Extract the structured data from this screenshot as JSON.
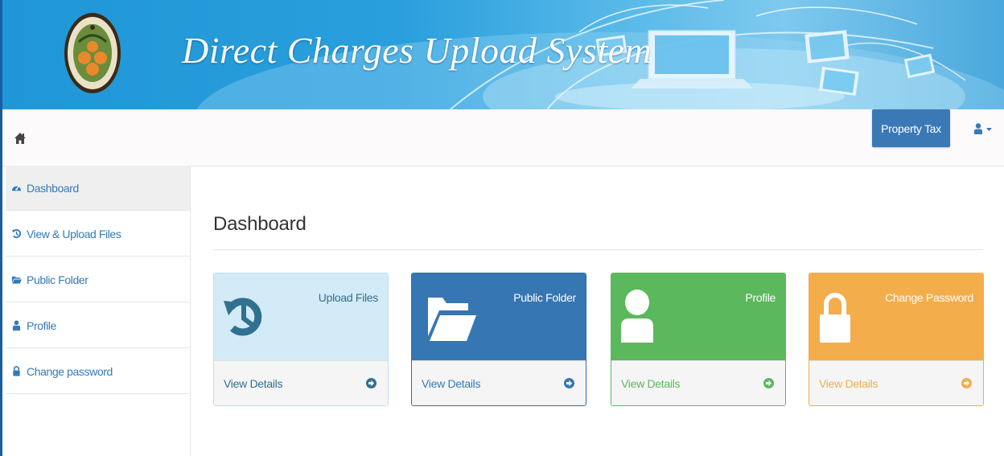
{
  "header": {
    "title": "Direct Charges Upload System",
    "seal_text": [
      "COUNTY",
      "ORANGE",
      "CALIFORNIA"
    ]
  },
  "nav": {
    "department_button": "Property Tax"
  },
  "sidebar": {
    "items": [
      {
        "label": "Dashboard",
        "icon": "dashboard-icon",
        "active": true
      },
      {
        "label": "View & Upload Files",
        "icon": "history-icon",
        "active": false
      },
      {
        "label": "Public Folder",
        "icon": "folder-open-icon",
        "active": false
      },
      {
        "label": "Profile",
        "icon": "user-icon",
        "active": false
      },
      {
        "label": "Change password",
        "icon": "lock-icon",
        "active": false
      }
    ]
  },
  "main": {
    "title": "Dashboard",
    "cards": [
      {
        "label": "Upload Files",
        "link": "View Details",
        "icon": "history-icon",
        "color": "#d3ebf7"
      },
      {
        "label": "Public Folder",
        "link": "View Details",
        "icon": "folder-open-icon",
        "color": "#3676b3"
      },
      {
        "label": "Profile",
        "link": "View Details",
        "icon": "user-icon",
        "color": "#5cb85c"
      },
      {
        "label": "Change Password",
        "link": "View Details",
        "icon": "lock-icon",
        "color": "#f4ad4b"
      }
    ]
  },
  "colors": {
    "banner": "#2a9fdd",
    "primary": "#337ab7",
    "success": "#5cb85c",
    "warning": "#f0ad4e",
    "info": "#31708f"
  }
}
